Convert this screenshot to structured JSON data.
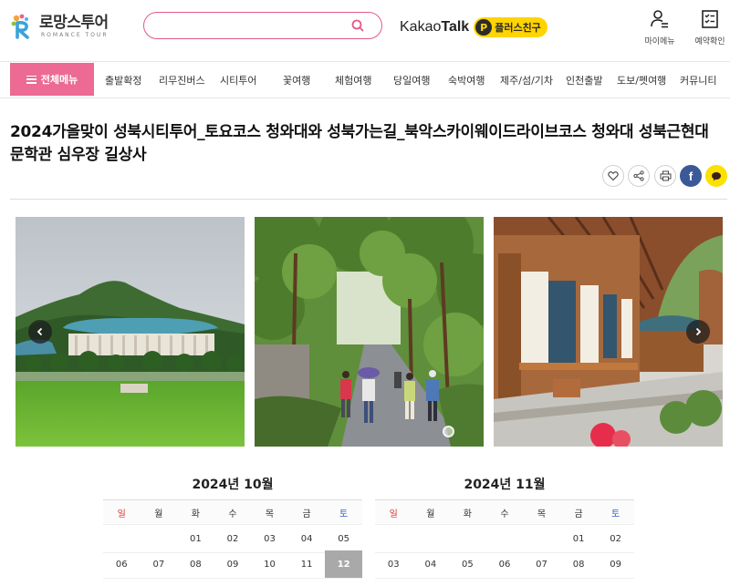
{
  "header": {
    "logo_main": "로망스투어",
    "logo_sub": "ROMANCE TOUR",
    "search_placeholder": "",
    "kakao_word_light": "Kakao",
    "kakao_word_bold": "Talk",
    "plus_friend_badge": "P",
    "plus_friend_label": "플러스친구",
    "my_menu_label": "마이메뉴",
    "reservation_label": "예약확인"
  },
  "nav": {
    "all_menu": "전체메뉴",
    "items": [
      "출발확정",
      "리무진버스",
      "시티투어",
      "꽃여행",
      "체험여행",
      "당일여행",
      "숙박여행",
      "제주/섬/기차",
      "인천출발",
      "도보/펫여행",
      "커뮤니티"
    ]
  },
  "article": {
    "title_line1": "2024가을맞이 성북시티투어_토요코스 청와대와 성북가는길_북악스카이웨이드라이브코스 청와대 성북근현대",
    "title_line2": "문학관 심우장 길상사",
    "share_facebook": "f"
  },
  "gallery": {
    "images": [
      "blue-house-photo",
      "forest-path-photo",
      "hanok-corridor-photo"
    ]
  },
  "calendars": [
    {
      "title": "2024년 10월",
      "weekdays": [
        "일",
        "월",
        "화",
        "수",
        "목",
        "금",
        "토"
      ],
      "rows": [
        [
          "",
          "",
          "01",
          "02",
          "03",
          "04",
          "05"
        ],
        [
          "06",
          "07",
          "08",
          "09",
          "10",
          "11",
          "12"
        ]
      ],
      "selected": "12"
    },
    {
      "title": "2024년 11월",
      "weekdays": [
        "일",
        "월",
        "화",
        "수",
        "목",
        "금",
        "토"
      ],
      "rows": [
        [
          "",
          "",
          "",
          "",
          "",
          "01",
          "02"
        ],
        [
          "03",
          "04",
          "05",
          "06",
          "07",
          "08",
          "09"
        ]
      ],
      "selected": ""
    }
  ],
  "colors": {
    "brand_pink": "#ec6a93",
    "search_border": "#e35a86",
    "kakao_yellow": "#ffd400",
    "sunday_red": "#e2322f",
    "saturday_blue": "#3b63c8",
    "selected_gray": "#a9a9a9"
  }
}
